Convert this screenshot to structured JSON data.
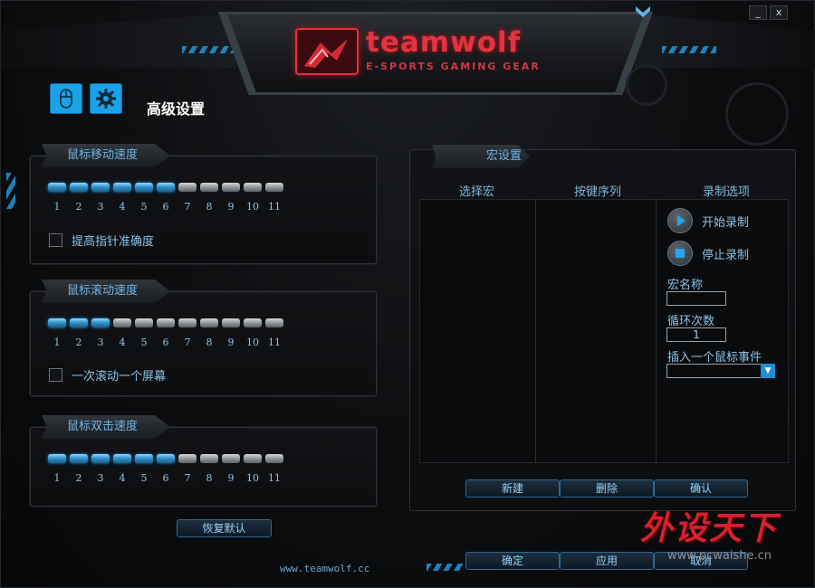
{
  "window": {
    "minimize_label": "_",
    "close_label": "x"
  },
  "brand": {
    "wordmark": "teamwolf",
    "tagline": "E-SPORTS GAMING GEAR",
    "accent_red": "#e23340",
    "accent_blue": "#1aa3e8"
  },
  "toolbar": {
    "mouse_icon": "mouse-icon",
    "settings_icon": "gear-icon"
  },
  "page_title": "高级设置",
  "panels": {
    "move_speed": {
      "title": "鼠标移动速度",
      "levels": [
        "1",
        "2",
        "3",
        "4",
        "5",
        "6",
        "7",
        "8",
        "9",
        "10",
        "11"
      ],
      "active_count": 6,
      "checkbox_label": "提高指针准确度",
      "checked": false
    },
    "scroll_speed": {
      "title": "鼠标滚动速度",
      "levels": [
        "1",
        "2",
        "3",
        "4",
        "5",
        "6",
        "7",
        "8",
        "9",
        "10",
        "11"
      ],
      "active_count": 3,
      "checkbox_label": "一次滚动一个屏幕",
      "checked": false
    },
    "double_click": {
      "title": "鼠标双击速度",
      "levels": [
        "1",
        "2",
        "3",
        "4",
        "5",
        "6",
        "7",
        "8",
        "9",
        "10",
        "11"
      ],
      "active_count": 6
    }
  },
  "restore_default_label": "恢复默认",
  "footer_url": "www.teamwolf.cc",
  "macro": {
    "title": "宏设置",
    "col_select": "选择宏",
    "col_sequence": "按键序列",
    "col_options": "录制选项",
    "start_record": "开始录制",
    "stop_record": "停止录制",
    "name_label": "宏名称",
    "name_value": "",
    "loop_label": "循环次数",
    "loop_value": "1",
    "insert_label": "插入一个鼠标事件",
    "insert_value": "",
    "btn_new": "新建",
    "btn_delete": "删除",
    "btn_confirm": "确认"
  },
  "footer_buttons": {
    "ok": "确定",
    "apply": "应用",
    "cancel": "取消"
  },
  "watermark": {
    "text": "外设天下",
    "url": "www.pcwaishe.cn"
  }
}
